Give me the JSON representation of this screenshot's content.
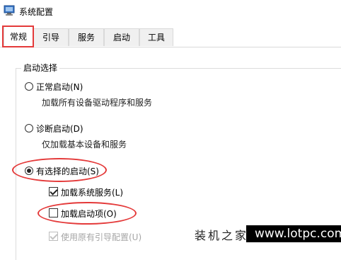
{
  "window": {
    "title": "系统配置",
    "icon": "system-config-icon"
  },
  "tabs": [
    {
      "label": "常规",
      "active": true
    },
    {
      "label": "引导",
      "active": false
    },
    {
      "label": "服务",
      "active": false
    },
    {
      "label": "启动",
      "active": false
    },
    {
      "label": "工具",
      "active": false
    }
  ],
  "startup": {
    "group_label": "启动选择",
    "normal": {
      "label": "正常启动(N)",
      "desc": "加载所有设备驱动程序和服务",
      "selected": false
    },
    "diagnostic": {
      "label": "诊断启动(D)",
      "desc": "仅加载基本设备和服务",
      "selected": false
    },
    "selective": {
      "label": "有选择的启动(S)",
      "selected": true
    },
    "load_system_services": {
      "label": "加载系统服务(L)",
      "checked": true,
      "enabled": true
    },
    "load_startup_items": {
      "label": "加载启动项(O)",
      "checked": false,
      "enabled": true
    },
    "use_original_boot": {
      "label": "使用原有引导配置(U)",
      "checked": true,
      "enabled": false
    }
  },
  "watermark": {
    "text": "装机之家",
    "url": "www.lotpc.com"
  },
  "colors": {
    "highlight_red": "#e43a3a",
    "border_gray": "#d9d9d9"
  }
}
